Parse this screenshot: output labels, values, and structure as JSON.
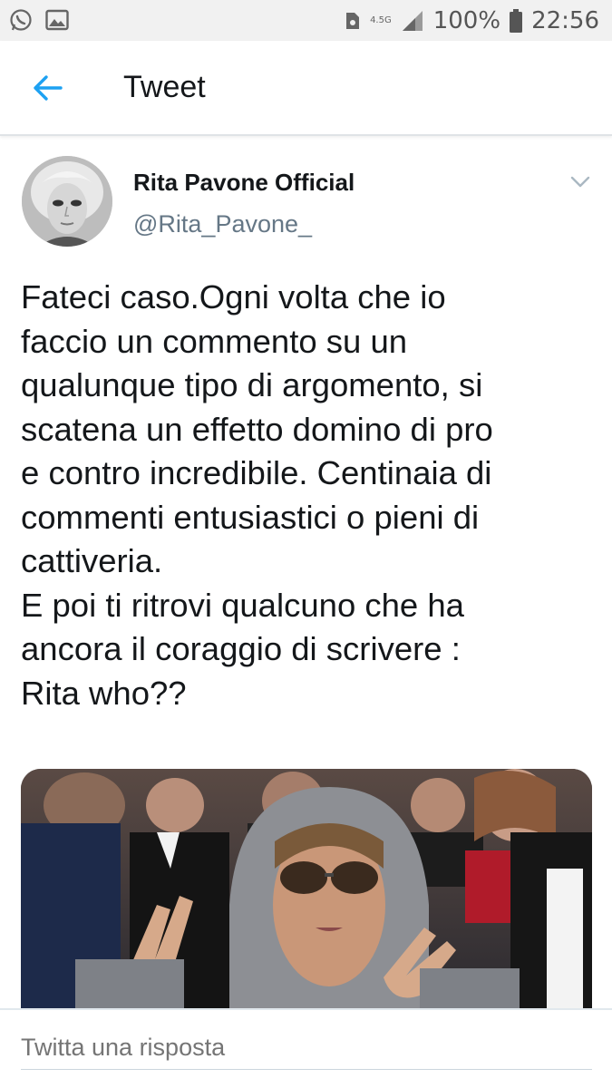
{
  "status_bar": {
    "network": "4.5G",
    "battery": "100%",
    "time": "22:56",
    "icons": [
      "whatsapp-icon",
      "image-icon",
      "sim-icon",
      "signal-icon",
      "battery-icon"
    ]
  },
  "header": {
    "back_icon": "back-arrow-icon",
    "title": "Tweet"
  },
  "tweet": {
    "author_name": "Rita Pavone Official",
    "author_handle": "@Rita_Pavone_",
    "text": "Fateci caso.Ogni volta che io\nfaccio un commento su un\nqualunque tipo di argomento, si\nscatena un effetto domino di pro\ne contro incredibile. Centinaia di\ncommenti entusiastici o pieni di\ncattiveria.\nE poi ti ritrovi qualcuno che ha\nancora il coraggio di scrivere :\nRita who??",
    "menu_icon": "chevron-down-icon"
  },
  "reply": {
    "placeholder": "Twitta una risposta"
  },
  "colors": {
    "accent": "#1da1f2",
    "secondary_text": "#657786",
    "primary_text": "#14171a"
  }
}
